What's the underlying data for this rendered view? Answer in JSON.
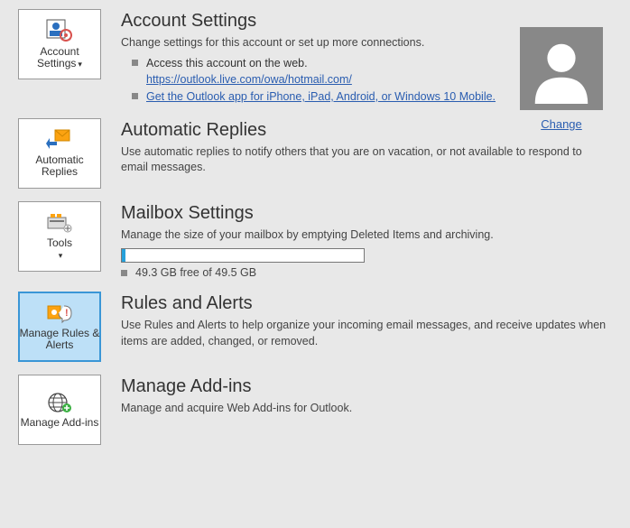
{
  "accountSettings": {
    "tile": "Account Settings",
    "heading": "Account Settings",
    "desc": "Change settings for this account or set up more connections.",
    "bullet1": "Access this account on the web.",
    "bullet1_link": "https://outlook.live.com/owa/hotmail.com/",
    "bullet2_link": "Get the Outlook app for iPhone, iPad, Android, or Windows 10 Mobile."
  },
  "avatar": {
    "change": "Change"
  },
  "autoReplies": {
    "tile": "Automatic Replies",
    "heading": "Automatic Replies",
    "desc": "Use automatic replies to notify others that you are on vacation, or not available to respond to email messages."
  },
  "mailbox": {
    "tile": "Tools",
    "heading": "Mailbox Settings",
    "desc": "Manage the size of your mailbox by emptying Deleted Items and archiving.",
    "usage": "49.3 GB free of 49.5 GB"
  },
  "rules": {
    "tile": "Manage Rules & Alerts",
    "heading": "Rules and Alerts",
    "desc": "Use Rules and Alerts to help organize your incoming email messages, and receive updates when items are added, changed, or removed."
  },
  "addins": {
    "tile": "Manage Add-ins",
    "heading": "Manage Add-ins",
    "desc": "Manage and acquire Web Add-ins for Outlook."
  }
}
